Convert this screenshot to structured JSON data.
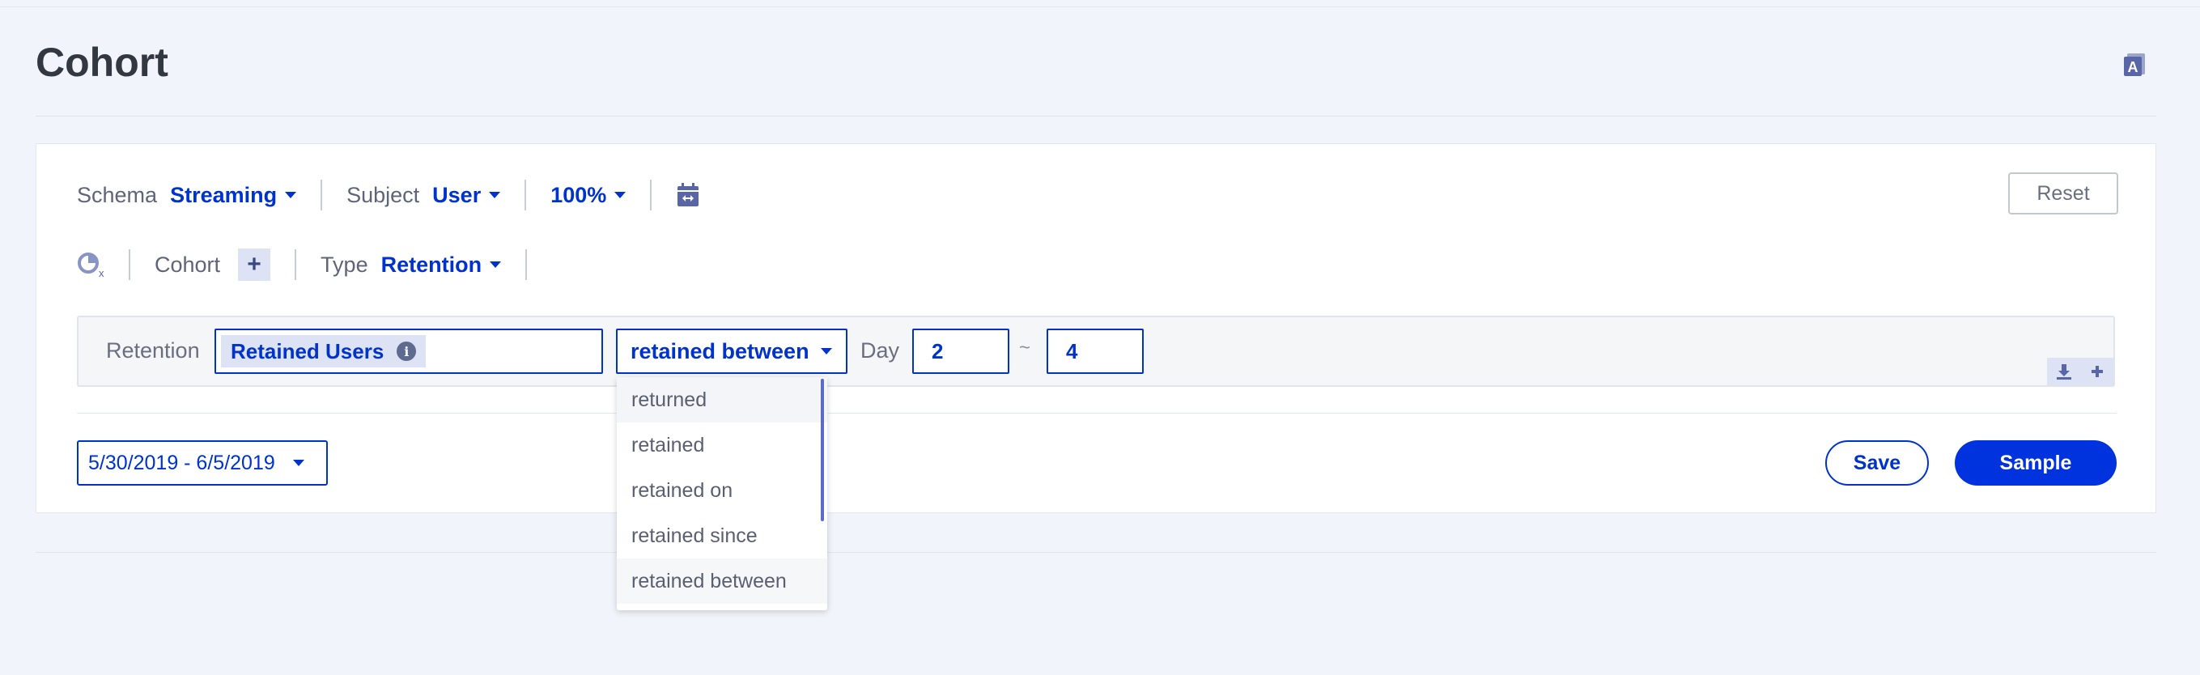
{
  "page": {
    "title": "Cohort"
  },
  "toolbar": {
    "schema_label": "Schema",
    "schema_value": "Streaming",
    "subject_label": "Subject",
    "subject_value": "User",
    "sampling_value": "100%",
    "reset_label": "Reset"
  },
  "cohort_row": {
    "cohort_label": "Cohort",
    "add_symbol": "+",
    "type_label": "Type",
    "type_value": "Retention"
  },
  "retention": {
    "label": "Retention",
    "chip_label": "Retained Users",
    "info_symbol": "i",
    "condition_value": "retained between",
    "day_label": "Day",
    "day_from": "2",
    "range_separator": "~",
    "day_to": "4"
  },
  "condition_dropdown": {
    "options": [
      "returned",
      "retained",
      "retained on",
      "retained since",
      "retained between"
    ],
    "hovered": "returned",
    "selected": "retained between"
  },
  "footer": {
    "date_range": "5/30/2019 - 6/5/2019",
    "save_label": "Save",
    "sample_label": "Sample"
  },
  "colors": {
    "accent": "#0033cc",
    "page_bg": "#f1f4fb",
    "chip_bg": "#dde3f4"
  }
}
